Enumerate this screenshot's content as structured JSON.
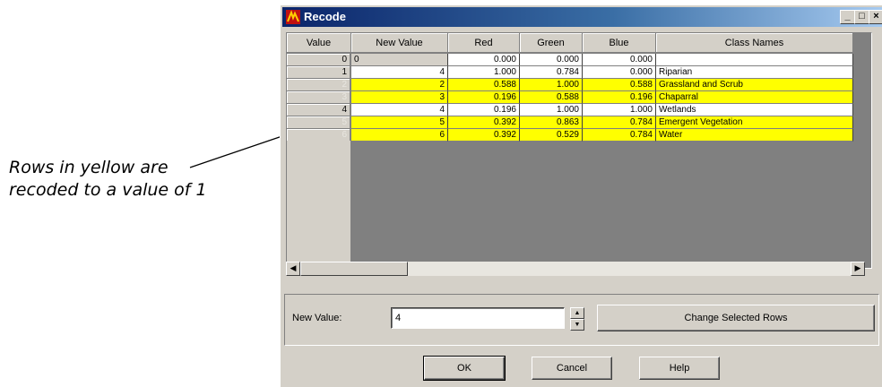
{
  "callout": {
    "line1": "Rows in yellow are",
    "line2": "recoded to a value of 1"
  },
  "window": {
    "title": "Recode",
    "min": "_",
    "max": "□",
    "close": "×"
  },
  "table": {
    "columns": [
      "Value",
      "New Value",
      "Red",
      "Green",
      "Blue",
      "Class Names"
    ],
    "rows": [
      {
        "value": "0",
        "new_value": "0",
        "red": "0.000",
        "green": "0.000",
        "blue": "0.000",
        "class_name": "",
        "highlight": false
      },
      {
        "value": "1",
        "new_value": "4",
        "red": "1.000",
        "green": "0.784",
        "blue": "0.000",
        "class_name": "Riparian",
        "highlight": false
      },
      {
        "value": "2",
        "new_value": "2",
        "red": "0.588",
        "green": "1.000",
        "blue": "0.588",
        "class_name": "Grassland and Scrub",
        "highlight": true
      },
      {
        "value": "3",
        "new_value": "3",
        "red": "0.196",
        "green": "0.588",
        "blue": "0.196",
        "class_name": "Chaparral",
        "highlight": true
      },
      {
        "value": "4",
        "new_value": "4",
        "red": "0.196",
        "green": "1.000",
        "blue": "1.000",
        "class_name": "Wetlands",
        "highlight": false
      },
      {
        "value": "5",
        "new_value": "5",
        "red": "0.392",
        "green": "0.863",
        "blue": "0.784",
        "class_name": "Emergent Vegetation",
        "highlight": true
      },
      {
        "value": "6",
        "new_value": "6",
        "red": "0.392",
        "green": "0.529",
        "blue": "0.784",
        "class_name": "Water",
        "highlight": true
      }
    ]
  },
  "controls": {
    "new_value_label": "New Value:",
    "new_value": "4",
    "change_button": "Change Selected Rows",
    "ok": "OK",
    "cancel": "Cancel",
    "help": "Help"
  },
  "colors": {
    "highlight": "#ffff00",
    "title_start": "#0a246a",
    "title_end": "#a6caf0"
  }
}
